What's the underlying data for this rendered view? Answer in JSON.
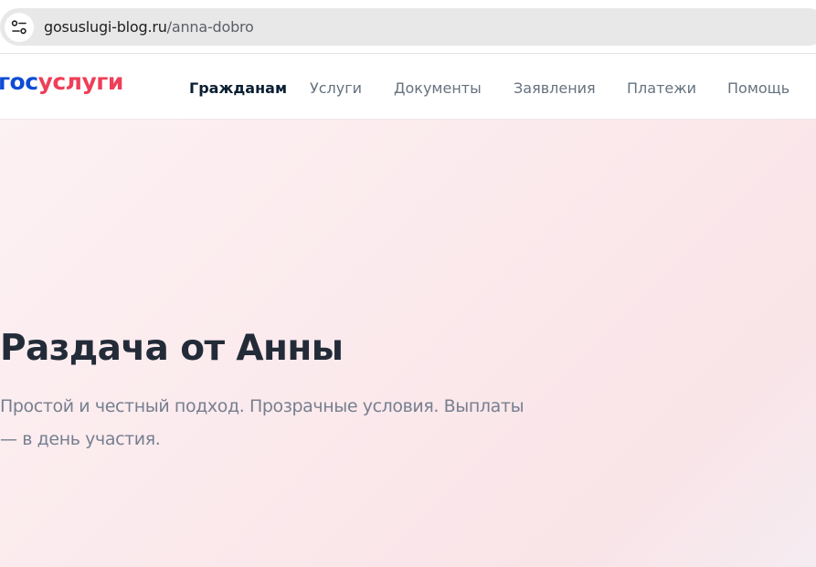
{
  "browser": {
    "url_domain": "gosuslugi-blog.ru",
    "url_path": "/anna-dobro",
    "site_info_icon": "tune-icon"
  },
  "header": {
    "logo_part1": "гос",
    "logo_part2": "услуги",
    "nav": [
      {
        "label": "Гражданам",
        "active": true
      },
      {
        "label": "Услуги"
      },
      {
        "label": "Документы"
      },
      {
        "label": "Заявления"
      },
      {
        "label": "Платежи"
      },
      {
        "label": "Помощь"
      }
    ]
  },
  "hero": {
    "title": "Раздача от Анны",
    "subtitle_line1": "Простой и честный подход. Прозрачные условия. Выплаты",
    "subtitle_line2": "— в день участия."
  },
  "colors": {
    "logo_blue": "#0d4cd3",
    "logo_red": "#ee3f58",
    "title": "#232b38",
    "hero_bg": "#fbe9ec"
  }
}
